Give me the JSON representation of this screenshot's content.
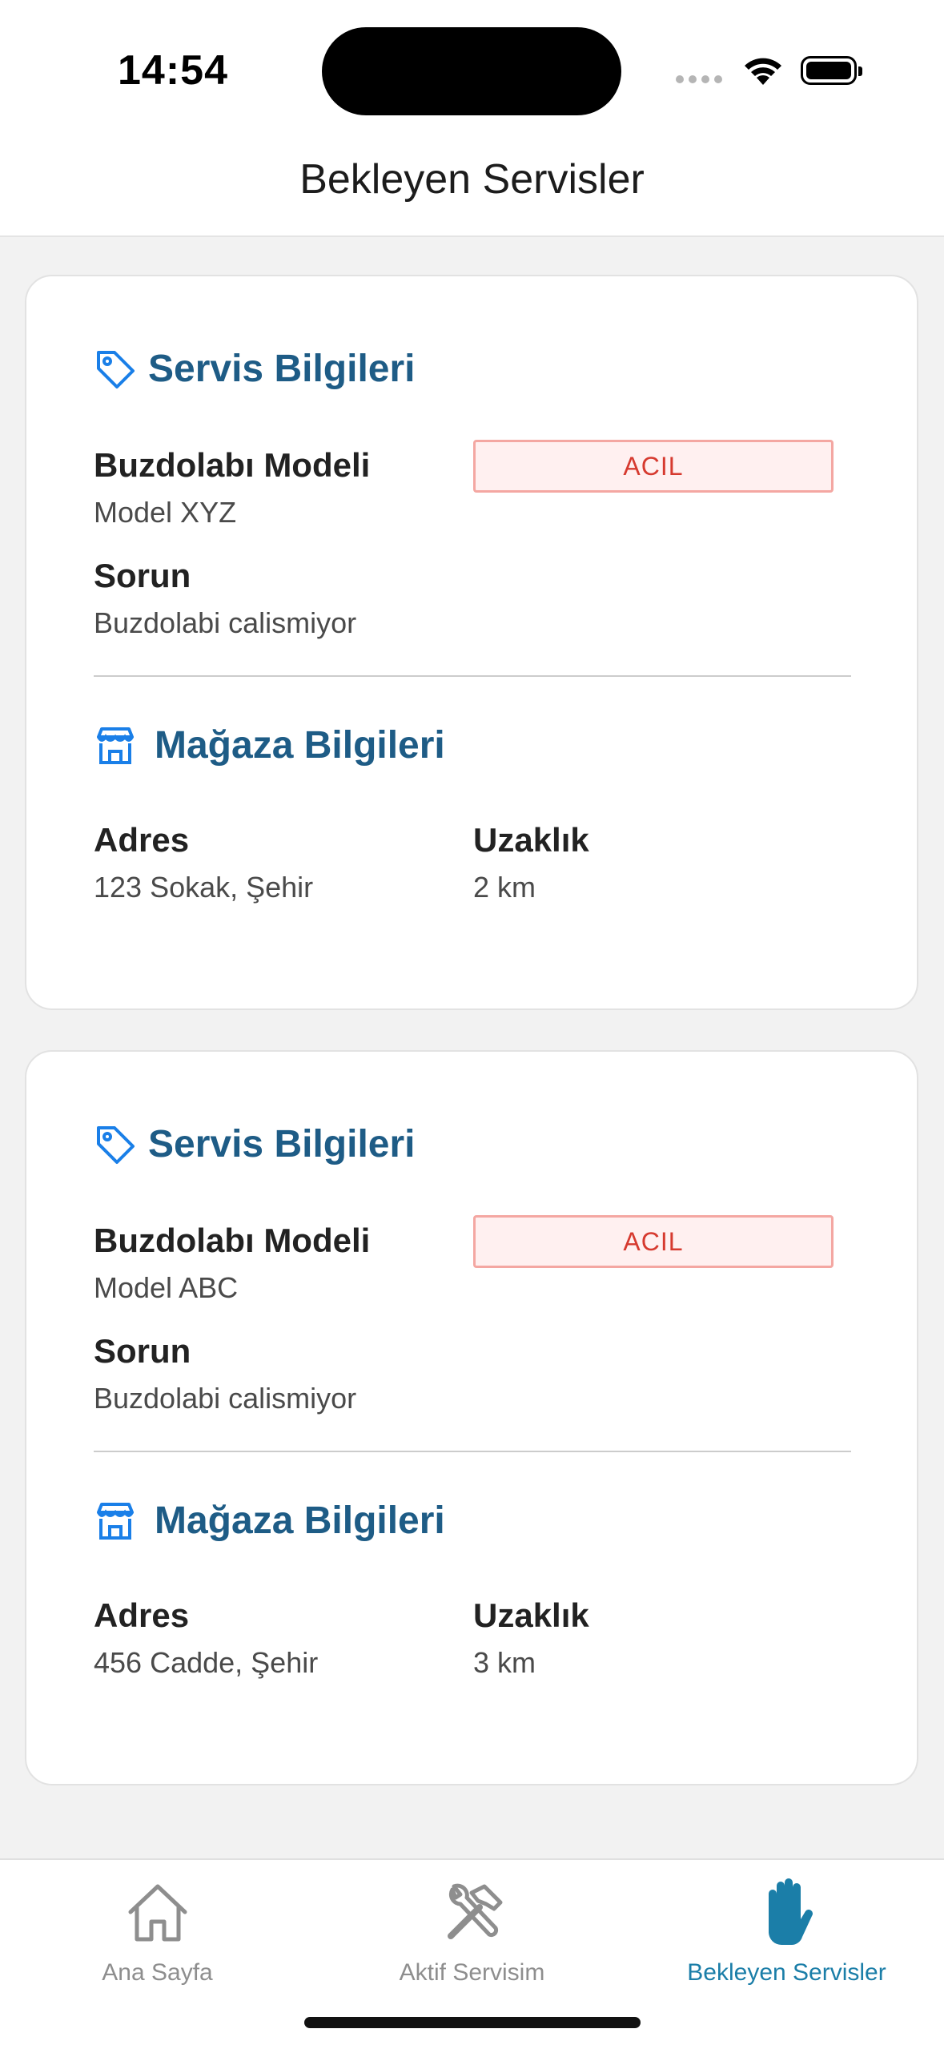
{
  "status_bar": {
    "time": "14:54"
  },
  "header": {
    "title": "Bekleyen Servisler"
  },
  "colors": {
    "section_title": "#1e5c86",
    "icon_blue": "#1a7fe8",
    "badge_text": "#d63a2f",
    "badge_bg": "#fff0f0",
    "badge_border": "#f4a7a2",
    "tab_active": "#1b7ea8",
    "tab_inactive": "#8e8e8e"
  },
  "labels": {
    "service_section": "Servis Bilgileri",
    "store_section": "Mağaza Bilgileri",
    "model": "Buzdolabı Modeli",
    "problem": "Sorun",
    "address": "Adres",
    "distance": "Uzaklık"
  },
  "services": [
    {
      "model": "Model XYZ",
      "priority": "ACIL",
      "problem": "Buzdolabi calismiyor",
      "address": "123 Sokak, Şehir",
      "distance": "2 km"
    },
    {
      "model": "Model ABC",
      "priority": "ACIL",
      "problem": "Buzdolabi calismiyor",
      "address": "456 Cadde, Şehir",
      "distance": "3 km"
    }
  ],
  "tabs": [
    {
      "label": "Ana Sayfa",
      "icon": "home-icon",
      "active": false
    },
    {
      "label": "Aktif Servisim",
      "icon": "tools-icon",
      "active": false
    },
    {
      "label": "Bekleyen Servisler",
      "icon": "hand-icon",
      "active": true
    }
  ]
}
